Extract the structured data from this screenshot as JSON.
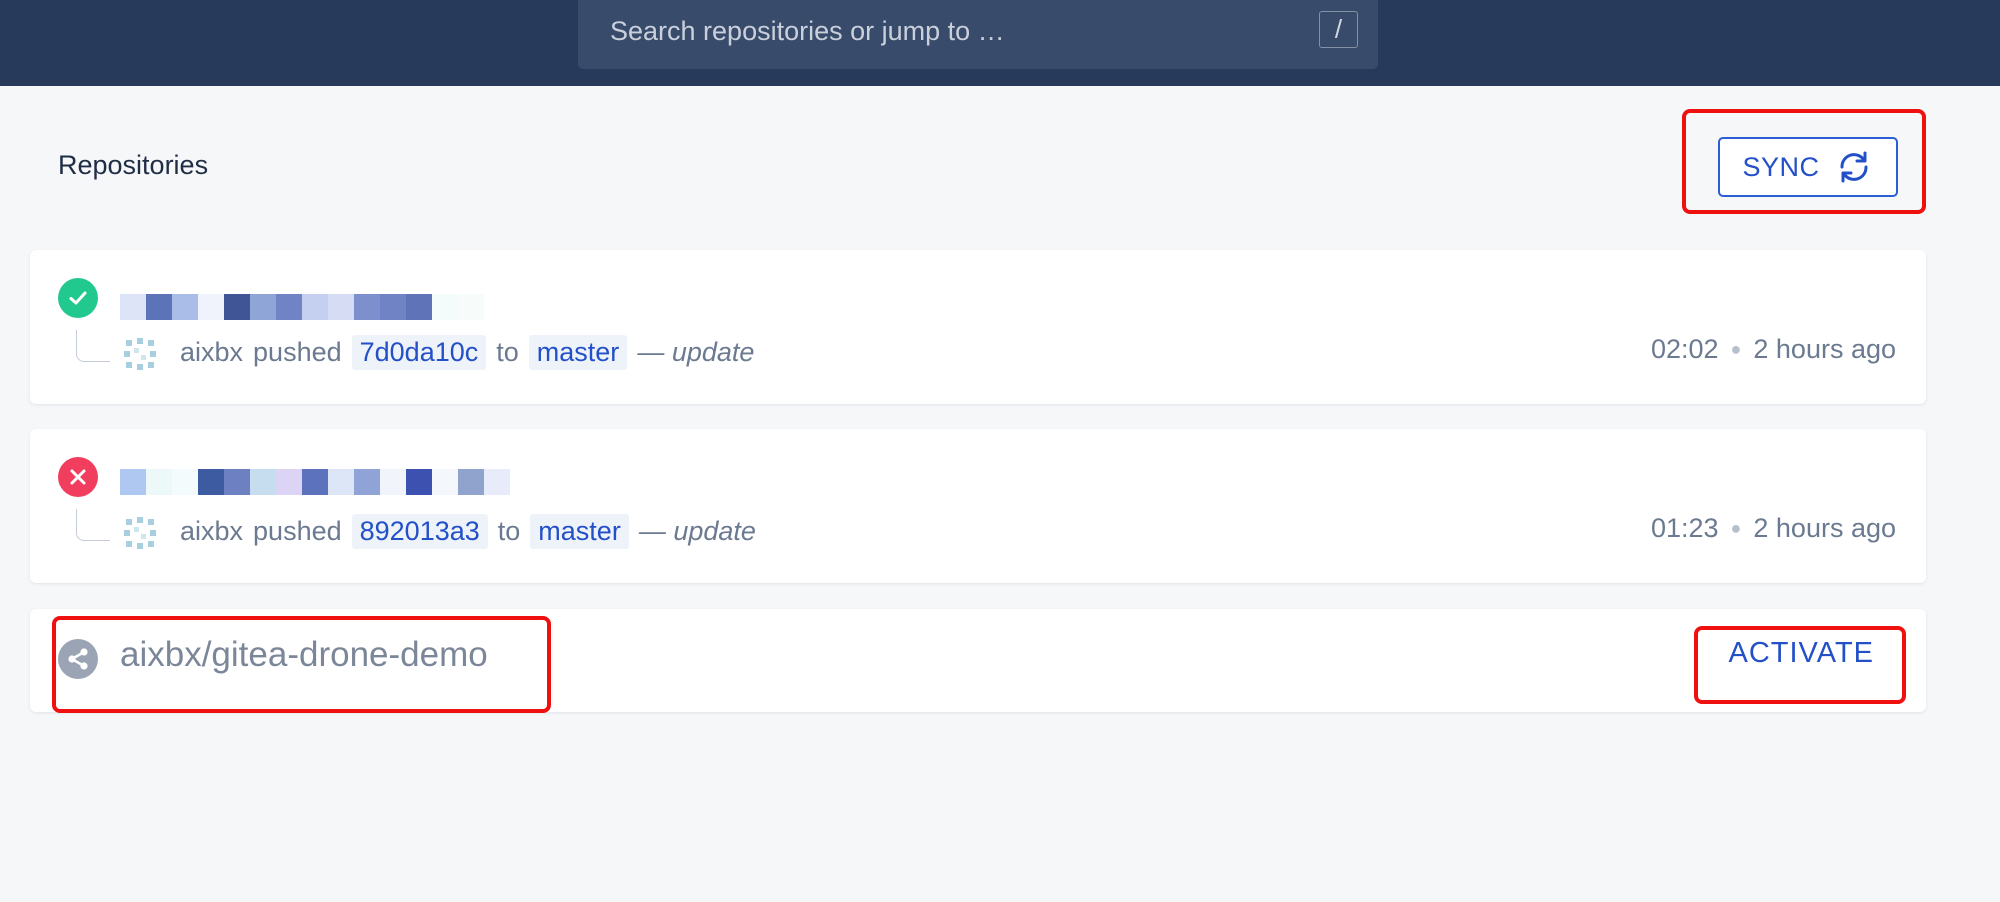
{
  "search": {
    "placeholder": "Search repositories or jump to …",
    "shortcut": "/"
  },
  "page": {
    "title": "Repositories",
    "sync_label": "SYNC"
  },
  "builds": [
    {
      "status": "success",
      "author": "aixbx",
      "action": "pushed",
      "commit": "7d0da10c",
      "to": "to",
      "branch": "master",
      "message": "— update",
      "time": "02:02",
      "ago": "2 hours ago"
    },
    {
      "status": "failure",
      "author": "aixbx",
      "action": "pushed",
      "commit": "892013a3",
      "to": "to",
      "branch": "master",
      "message": "— update",
      "time": "01:23",
      "ago": "2 hours ago"
    }
  ],
  "inactive_repo": {
    "name": "aixbx/gitea-drone-demo",
    "activate_label": "ACTIVATE"
  },
  "colors": {
    "header_bg": "#283a5b",
    "accent": "#2350c8",
    "success": "#22c98e",
    "failure": "#f23e5e",
    "highlight_box": "#ef1010"
  },
  "icons": {
    "sync": "sync-icon",
    "success": "check-icon",
    "failure": "close-icon",
    "repo": "share-icon"
  }
}
